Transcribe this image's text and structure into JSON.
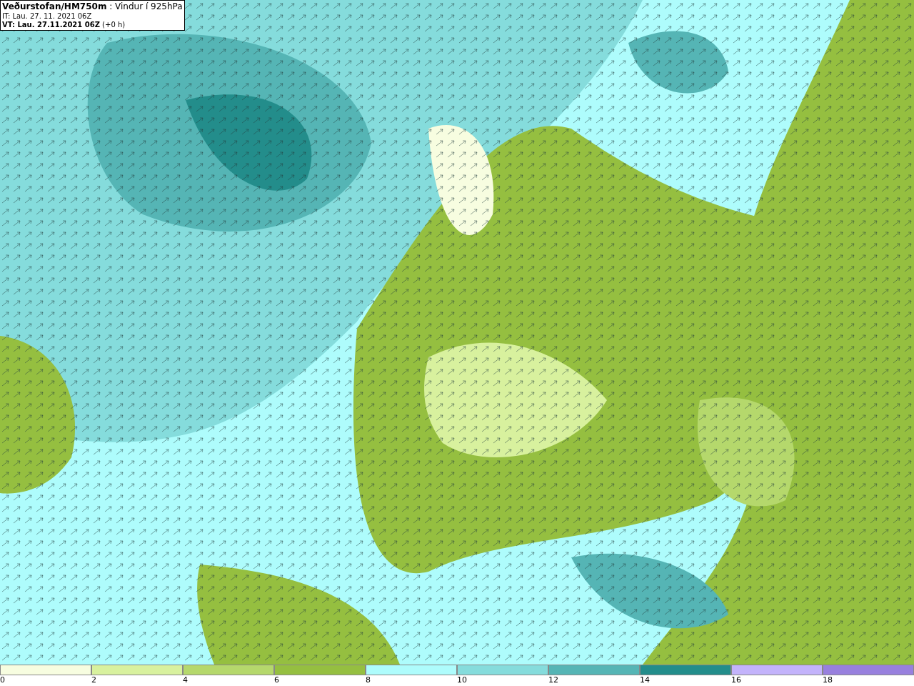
{
  "header": {
    "lines": [
      "**Veðurstofan/HM750m** : Vindur í 925hPa",
      "IT: Lau. 27. 11. 2021 06Z",
      "**VT: Lau. 27.11.2021 06Z** (+0 h)"
    ]
  },
  "legend": {
    "segments": [
      {
        "label": "0",
        "color": "#f7fde0"
      },
      {
        "label": "2",
        "color": "#d8f19e"
      },
      {
        "label": "4",
        "color": "#b5d86c"
      },
      {
        "label": "6",
        "color": "#95bf40"
      },
      {
        "label": "8",
        "color": "#aefcfc"
      },
      {
        "label": "10",
        "color": "#85dcdc"
      },
      {
        "label": "12",
        "color": "#55b5b5"
      },
      {
        "label": "14",
        "color": "#238d8b"
      },
      {
        "label": "16",
        "color": "#c3b3fb"
      },
      {
        "label": "18",
        "color": "#9880de"
      }
    ]
  }
}
